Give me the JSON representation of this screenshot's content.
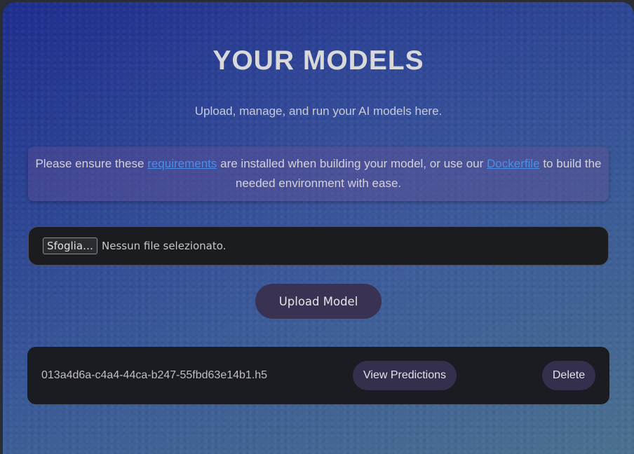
{
  "page": {
    "title": "YOUR MODELS",
    "subtitle": "Upload, manage, and run your AI models here."
  },
  "notice": {
    "text_before": "Please ensure these ",
    "requirements_link": "requirements",
    "text_middle": " are installed when building your model, or use our ",
    "dockerfile_link": "Dockerfile",
    "text_after": " to build the needed environment with ease."
  },
  "file_input": {
    "browse_label": "Sfoglia…",
    "status": "Nessun file selezionato."
  },
  "upload_button": {
    "label": "Upload Model"
  },
  "models": [
    {
      "name": "013a4d6a-c4a4-44ca-b247-55fbd63e14b1.h5",
      "view_label": "View Predictions",
      "delete_label": "Delete"
    }
  ],
  "colors": {
    "background_top": "#1e2f8f",
    "background_bottom": "#4b7190",
    "link": "#4a8ee8",
    "button": "#3a3253",
    "card": "#1b1c21"
  }
}
